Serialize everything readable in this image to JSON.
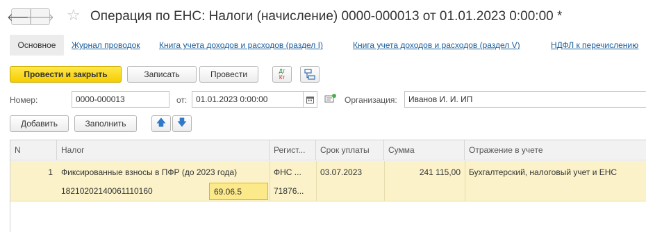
{
  "window": {
    "title": "Операция по ЕНС: Налоги (начисление) 0000-000013 от 01.01.2023 0:00:00 *",
    "back_glyph": "🡐",
    "forward_glyph": "🡒",
    "star_glyph": "☆"
  },
  "tabs": {
    "main": "Основное",
    "links": [
      "Журнал проводок",
      "Книга учета доходов и расходов (раздел I)",
      "Книга учета доходов и расходов (раздел V)",
      "НДФЛ к перечислению"
    ]
  },
  "toolbar": {
    "post_close": "Провести и закрыть",
    "save": "Записать",
    "post": "Провести",
    "dtkt_top": "Дт",
    "dtkt_bottom": "Кт"
  },
  "form": {
    "number_label": "Номер:",
    "number_value": "0000-000013",
    "date_label": "от:",
    "date_value": "01.01.2023  0:00:00",
    "org_label": "Организация:",
    "org_value": "Иванов И. И. ИП"
  },
  "table_toolbar": {
    "add": "Добавить",
    "fill": "Заполнить",
    "up_glyph": "🡅",
    "down_glyph": "🡇"
  },
  "table": {
    "headers": [
      "N",
      "Налог",
      "Регист...",
      "Срок уплаты",
      "Сумма",
      "Отражение в учете"
    ],
    "rows": [
      {
        "n": "1",
        "tax": "Фиксированные взносы в ПФР (до 2023 года)",
        "kbk": "18210202140061110160",
        "account": "69.06.5",
        "registrator": "ФНС ...",
        "registrator_code": "71876...",
        "due_date": "03.07.2023",
        "amount": "241 115,00",
        "reflection": "Бухгалтерский, налоговый учет и ЕНС"
      }
    ]
  },
  "colors": {
    "accent_yellow": "#f5cd00",
    "selected_row": "#fbf2c9",
    "link_blue": "#1b5d9a"
  }
}
